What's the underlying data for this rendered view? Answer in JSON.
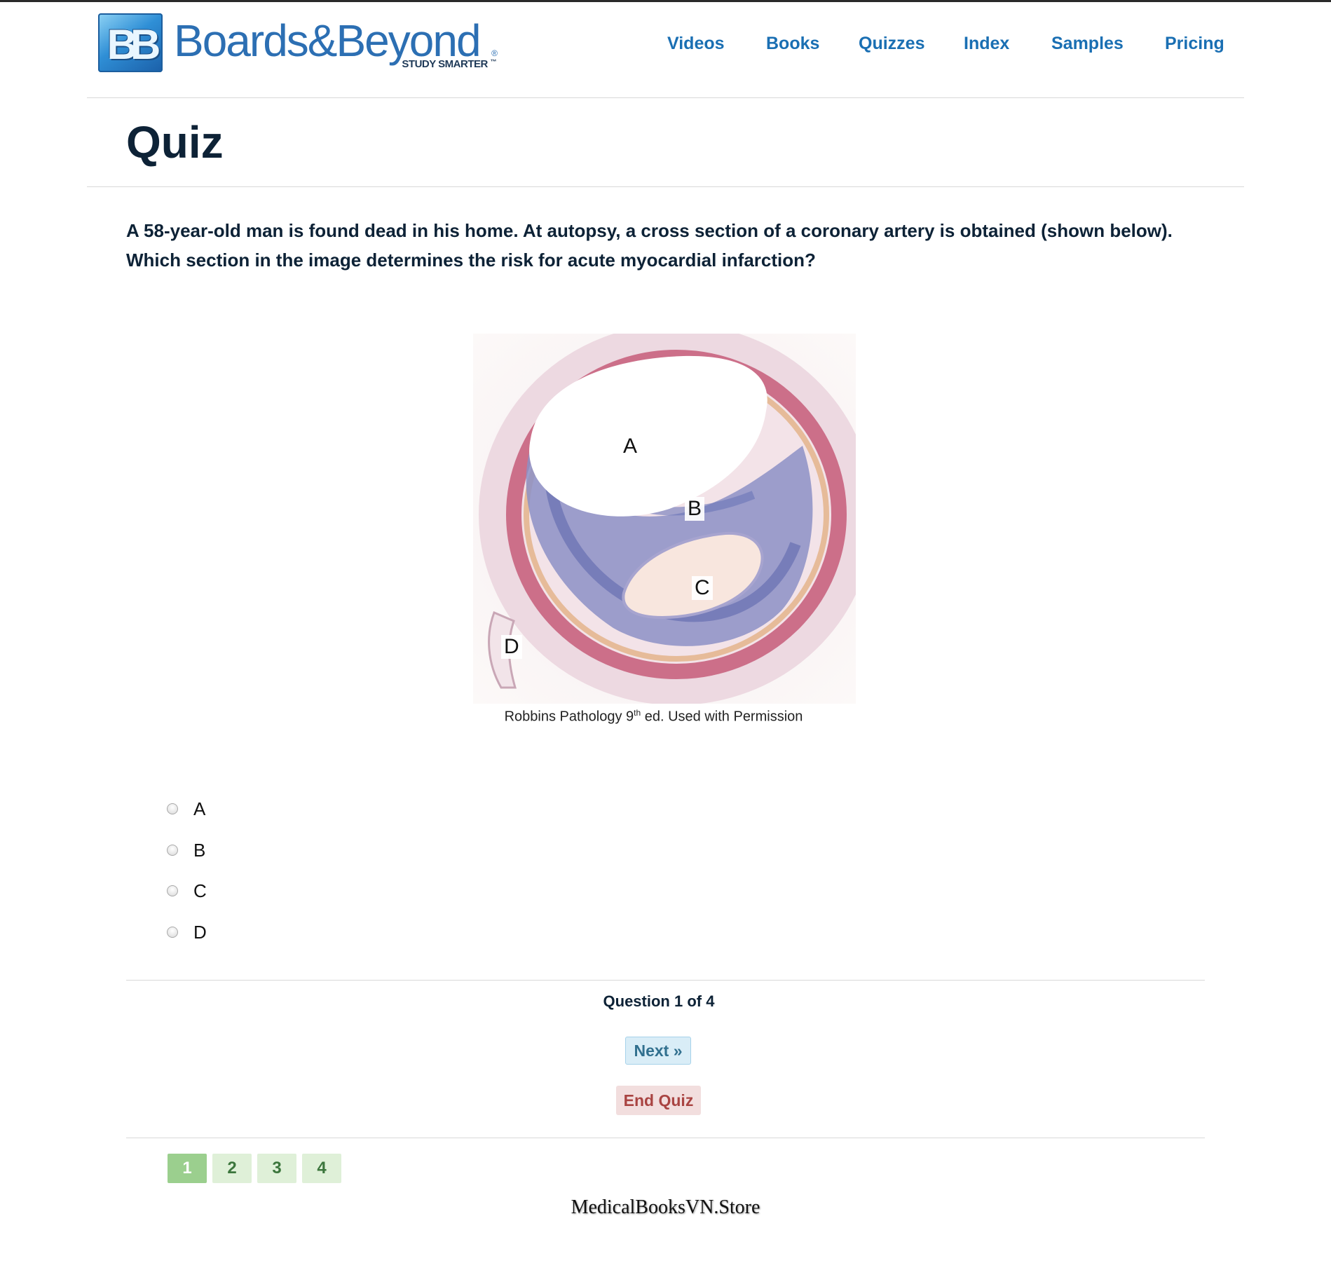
{
  "brand": {
    "mark": "BB",
    "name": "Boards&Beyond",
    "tagline": "STUDY SMARTER",
    "tagline_tm": "™",
    "registered": "®",
    "color": "#2c6fb3"
  },
  "nav": {
    "items": [
      {
        "label": "Videos"
      },
      {
        "label": "Books"
      },
      {
        "label": "Quizzes"
      },
      {
        "label": "Index"
      },
      {
        "label": "Samples"
      },
      {
        "label": "Pricing"
      }
    ],
    "color": "#1a6fb3"
  },
  "page": {
    "title": "Quiz"
  },
  "question": {
    "text": "A 58-year-old man is found dead in his home. At autopsy, a cross section of a coronary artery is obtained (shown below). Which section in the image determines the risk for acute myocardial infarction?",
    "figure": {
      "labels": [
        "A",
        "B",
        "C",
        "D"
      ],
      "caption_prefix": "Robbins Pathology 9",
      "caption_sup": "th",
      "caption_suffix": " ed. Used with Permission"
    },
    "options": [
      {
        "label": "A",
        "selected": false
      },
      {
        "label": "B",
        "selected": false
      },
      {
        "label": "C",
        "selected": false
      },
      {
        "label": "D",
        "selected": false
      }
    ]
  },
  "progress": {
    "prefix": "Question ",
    "current": "1",
    "of_word": " of ",
    "total": "4"
  },
  "buttons": {
    "next": "Next »",
    "end": "End Quiz"
  },
  "pagination": {
    "pages": [
      "1",
      "2",
      "3",
      "4"
    ],
    "active": "1",
    "colors": {
      "active": "#9bcf8e",
      "inactive": "#dff0d8"
    }
  },
  "watermark": "MedicalBooksVN.Store"
}
